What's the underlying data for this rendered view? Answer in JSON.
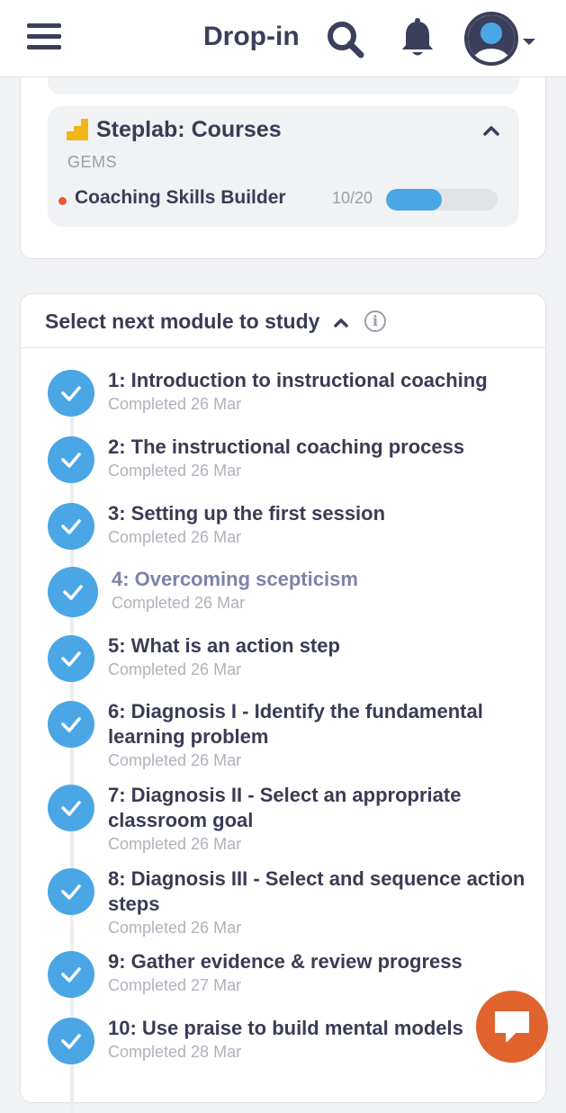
{
  "header": {
    "brand": "Drop-in",
    "icons": [
      "menu-icon",
      "search-icon",
      "bell-icon",
      "avatar-icon",
      "caret-down-icon"
    ]
  },
  "steplab": {
    "title": "Steplab: Courses",
    "subtitle": "GEMS",
    "course": {
      "name": "Coaching Skills Builder",
      "count": "10/20",
      "progress": 0.5
    }
  },
  "modules": {
    "title": "Select next module to study",
    "items": [
      {
        "title": "1: Introduction to instructional coaching",
        "status": "Completed 26 Mar"
      },
      {
        "title": "2: The instructional coaching process",
        "status": "Completed 26 Mar"
      },
      {
        "title": "3: Setting up the first session",
        "status": "Completed 26 Mar"
      },
      {
        "title": "4: Overcoming scepticism",
        "status": "Completed 26 Mar",
        "active": true
      },
      {
        "title": "5: What is an action step",
        "status": "Completed 26 Mar"
      },
      {
        "title": "6: Diagnosis I - Identify the fundamental learning problem",
        "status": "Completed 26 Mar"
      },
      {
        "title": "7: Diagnosis II - Select an appropriate classroom goal",
        "status": "Completed 26 Mar"
      },
      {
        "title": "8: Diagnosis III - Select and sequence action steps",
        "status": "Completed 26 Mar"
      },
      {
        "title": "9: Gather evidence & review progress",
        "status": "Completed 27 Mar"
      },
      {
        "title": "10: Use praise to build mental models",
        "status": "Completed 28 Mar"
      }
    ]
  },
  "colors": {
    "accent": "#4aa6e4",
    "chat": "#e0622d",
    "status_dot": "#e55b33",
    "active_title": "#7c83a8"
  }
}
